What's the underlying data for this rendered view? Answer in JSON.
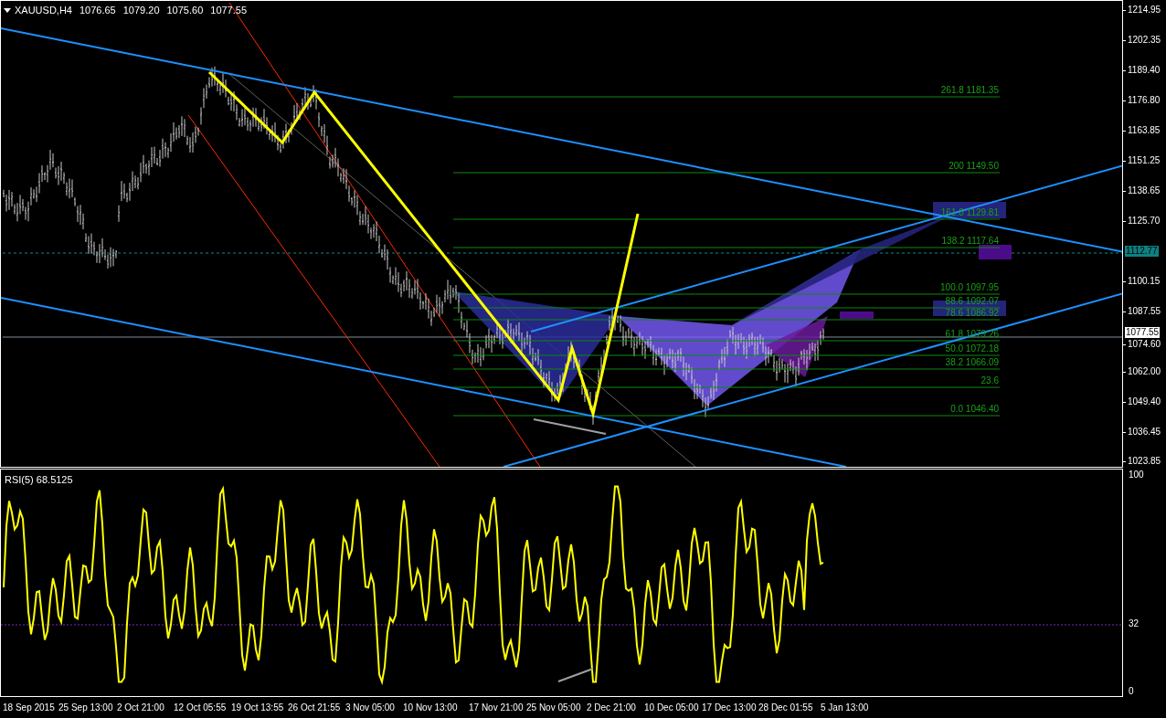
{
  "chart": {
    "symbol": "XAUUSD,H4",
    "quotes": [
      "1076.65",
      "1079.20",
      "1075.60",
      "1077.55"
    ],
    "price_axis": [
      "1214.95",
      "1202.35",
      "1189.40",
      "1176.80",
      "1163.85",
      "1151.25",
      "1138.65",
      "1125.70",
      "1100.15",
      "1087.55",
      "1074.60",
      "1062.00",
      "1049.40",
      "1036.45",
      "1023.85"
    ],
    "markers": [
      {
        "kind": "line",
        "label": "1112.77"
      },
      {
        "kind": "price",
        "label": "1077.55"
      }
    ],
    "fibonacci": [
      {
        "label": "261.8 1181.35"
      },
      {
        "label": "200 1149.50"
      },
      {
        "label": "161.8 1129.81"
      },
      {
        "label": "138.2 1117.64"
      },
      {
        "label": "100.0 1097.95"
      },
      {
        "label": "88.6 1092.07"
      },
      {
        "label": "78.6 1086.92"
      },
      {
        "label": "61.8 1079.26"
      },
      {
        "label": "50.0 1072.18"
      },
      {
        "label": "38.2 1066.09"
      },
      {
        "label": "23.6"
      },
      {
        "label": "0.0 1046.40"
      }
    ]
  },
  "indicator": {
    "name": "RSI(5) 68.5125",
    "axis": [
      "100",
      "32",
      "0"
    ]
  },
  "time_axis": [
    "18 Sep 2015",
    "25 Sep 13:00",
    "2 Oct 21:00",
    "12 Oct 05:55",
    "19 Oct 13:55",
    "26 Oct 21:55",
    "3 Nov 05:00",
    "10 Nov 13:00",
    "17 Nov 21:00",
    "25 Nov 05:00",
    "2 Dec 21:00",
    "10 Dec 05:00",
    "17 Dec 13:00",
    "28 Dec 01:55",
    "5 Jan 13:00"
  ]
}
